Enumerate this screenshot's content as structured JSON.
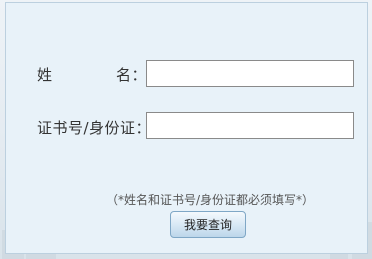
{
  "form": {
    "name_label_left": "姓",
    "name_label_right": "名：",
    "name_value": "",
    "id_label": "证书号/身份证：",
    "id_value": "",
    "hint": "（*姓名和证书号/身份证都必须填写*）",
    "submit_label": "我要查询"
  }
}
